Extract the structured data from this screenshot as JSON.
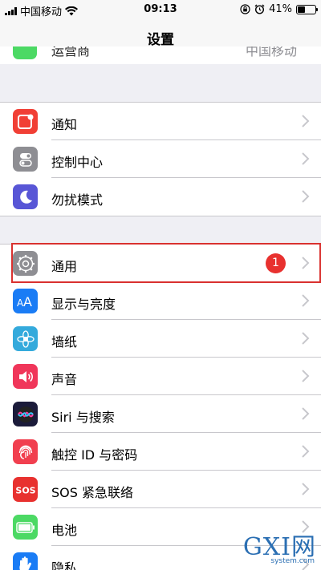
{
  "status_bar": {
    "carrier": "中国移动",
    "time": "09:13",
    "battery_percent": "41%",
    "battery_level": 0.41,
    "icons": [
      "signal-icon",
      "wifi-icon",
      "orientation-lock-icon",
      "alarm-icon",
      "battery-icon"
    ]
  },
  "nav": {
    "title": "设置"
  },
  "partial_row": {
    "label": "运营商",
    "value": "中国移动"
  },
  "group_1": [
    {
      "label": "通知",
      "icon": "notification-icon",
      "color": "#f13f35"
    },
    {
      "label": "控制中心",
      "icon": "control-center-icon",
      "color": "#8e8e93"
    },
    {
      "label": "勿扰模式",
      "icon": "moon-icon",
      "color": "#5856d6"
    }
  ],
  "group_2": [
    {
      "label": "通用",
      "icon": "gear-icon",
      "color": "#8e8e93",
      "badge": "1"
    },
    {
      "label": "显示与亮度",
      "icon": "display-icon",
      "color": "#1a7cf5"
    },
    {
      "label": "墙纸",
      "icon": "wallpaper-icon",
      "color": "#34aadc"
    },
    {
      "label": "声音",
      "icon": "speaker-icon",
      "color": "#f0365a"
    },
    {
      "label": "Siri 与搜索",
      "icon": "siri-icon",
      "color": "#1b1b3a"
    },
    {
      "label": "触控 ID 与密码",
      "icon": "fingerprint-icon",
      "color": "#f13f4f"
    },
    {
      "label": "SOS 紧急联络",
      "icon": "sos-icon",
      "color": "#e8312f",
      "icon_text": "SOS"
    },
    {
      "label": "电池",
      "icon": "battery-app-icon",
      "color": "#4cd964"
    },
    {
      "label": "隐私",
      "icon": "hand-icon",
      "color": "#1a7cf5"
    }
  ],
  "watermark": {
    "logo": "GXI网",
    "site": "system.com"
  }
}
